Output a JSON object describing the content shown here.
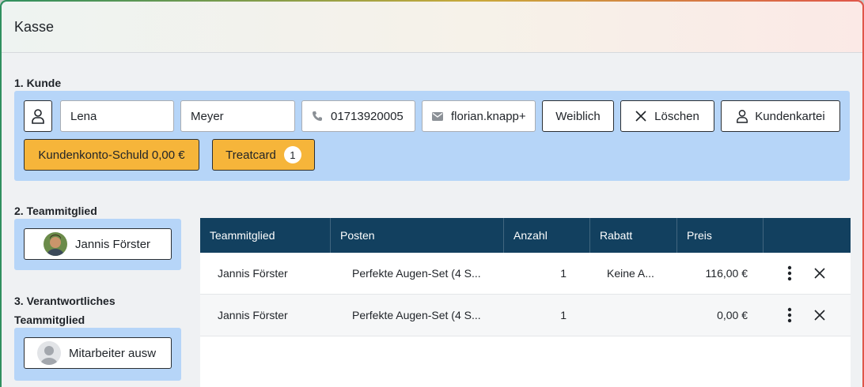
{
  "window": {
    "title": "Kasse"
  },
  "customer": {
    "section_label": "1. Kunde",
    "first_name": "Lena",
    "last_name": "Meyer",
    "phone": "01713920005",
    "email": "florian.knapp+",
    "gender_button": "Weiblich",
    "clear_button": "Löschen",
    "card_button": "Kundenkartei",
    "debt_button": "Kundenkonto-Schuld 0,00 €",
    "treatcard_button": "Treatcard",
    "treatcard_count": "1"
  },
  "team_member": {
    "section_label": "2. Teammitglied",
    "selected": "Jannis Förster"
  },
  "responsible": {
    "section_label_line1": "3. Verantwortliches",
    "section_label_line2": "Teammitglied",
    "placeholder": "Mitarbeiter ausw"
  },
  "table": {
    "headers": [
      "Teammitglied",
      "Posten",
      "Anzahl",
      "Rabatt",
      "Preis"
    ],
    "rows": [
      {
        "member": "Jannis Förster",
        "item": "Perfekte Augen-Set (4 S...",
        "qty": "1",
        "discount": "Keine A...",
        "price": "116,00 €"
      },
      {
        "member": "Jannis Förster",
        "item": "Perfekte Augen-Set (4 S...",
        "qty": "1",
        "discount": "",
        "price": "0,00 €"
      }
    ]
  },
  "colors": {
    "header_bg": "#12405f",
    "section_bg": "#b6d5f8",
    "accent_yellow": "#f6b53a"
  }
}
